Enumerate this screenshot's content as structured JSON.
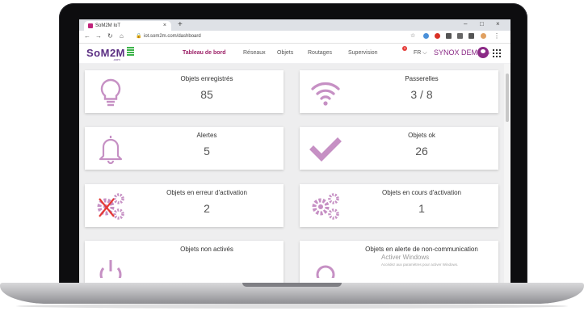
{
  "browser": {
    "tab_title": "SoM2M IoT",
    "tab_close": "×",
    "new_tab": "+",
    "window_minimize": "–",
    "window_maximize": "□",
    "window_close": "×",
    "url": "iot.som2m.com/dashboard"
  },
  "header": {
    "logo": "SoM2M",
    "logo_sub": ".com",
    "nav": [
      "Tableau de bord",
      "Réseaux",
      "Objets",
      "Routages",
      "Supervision"
    ],
    "supervision_badge": "3",
    "language": "FR ⌵",
    "organization": "SYNOX DEMO ⌵"
  },
  "cards": [
    {
      "label": "Objets enregistrés",
      "value": "85",
      "icon": "lightbulb-icon"
    },
    {
      "label": "Passerelles",
      "value": "3 / 8",
      "icon": "wifi-icon"
    },
    {
      "label": "Alertes",
      "value": "5",
      "icon": "bell-icon"
    },
    {
      "label": "Objets ok",
      "value": "26",
      "icon": "check-icon"
    },
    {
      "label": "Objets en erreur d'activation",
      "value": "2",
      "icon": "gears-error-icon"
    },
    {
      "label": "Objets en cours d'activation",
      "value": "1",
      "icon": "gears-icon"
    },
    {
      "label": "Objets non activés",
      "value": "",
      "icon": "power-icon"
    },
    {
      "label": "Objets en alerte de non-communication",
      "value": "",
      "icon": "no-communication-icon"
    }
  ],
  "watermark": {
    "title": "Activer Windows",
    "subtitle": "Accédez aux paramètres pour activer Windows."
  },
  "colors": {
    "accent": "#8b2a86",
    "icon": "#c690c4",
    "active_nav": "#9b1f66",
    "logo_green": "#3cb44a"
  }
}
